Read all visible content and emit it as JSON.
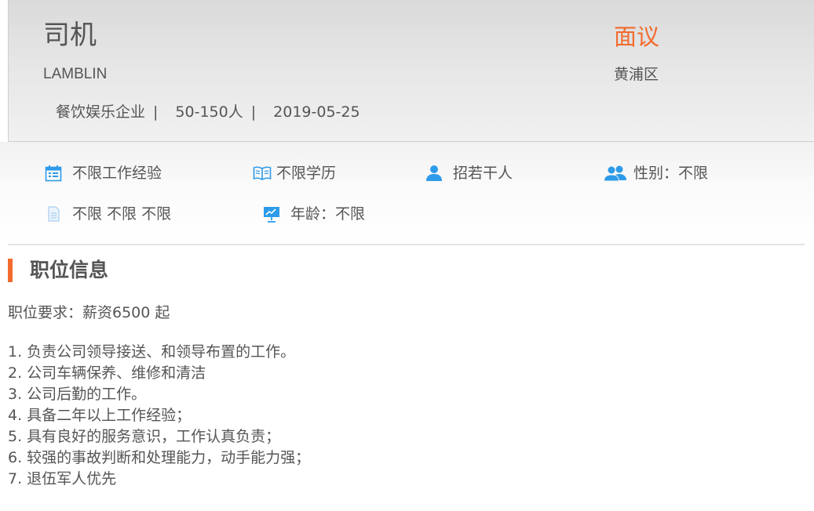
{
  "header": {
    "job_title": "司机",
    "company": "LAMBLIN",
    "industry": "餐饮娱乐企业",
    "company_size": "50-150人",
    "post_date": "2019-05-25",
    "separator": "|",
    "salary": "面议",
    "district": "黄浦区"
  },
  "colors": {
    "accent": "#f26b2d",
    "icon_blue": "#2e9bea",
    "text": "#555555"
  },
  "features": [
    {
      "icon": "calendar-icon",
      "label": "不限工作经验"
    },
    {
      "icon": "book-icon",
      "label": "不限学历"
    },
    {
      "icon": "person-icon",
      "label": "招若干人"
    },
    {
      "icon": "people-icon",
      "label": "性别：不限"
    },
    {
      "icon": "document-icon",
      "label": "不限 不限 不限"
    },
    {
      "icon": "presentation-icon",
      "label": "年龄：不限"
    }
  ],
  "section": {
    "title": "职位信息",
    "requirement": "职位要求：薪资6500 起",
    "duties": [
      "1. 负责公司领导接送、和领导布置的工作。",
      "2. 公司车辆保养、维修和清洁",
      "3. 公司后勤的工作。",
      "4. 具备二年以上工作经验；",
      "5. 具有良好的服务意识，工作认真负责；",
      "6. 较强的事故判断和处理能力，动手能力强；",
      "7. 退伍军人优先"
    ]
  }
}
